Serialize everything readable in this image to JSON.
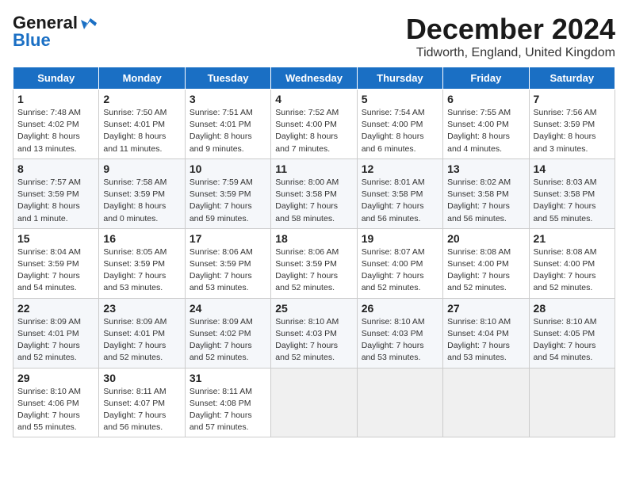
{
  "logo": {
    "line1": "General",
    "line2": "Blue"
  },
  "title": "December 2024",
  "subtitle": "Tidworth, England, United Kingdom",
  "days_of_week": [
    "Sunday",
    "Monday",
    "Tuesday",
    "Wednesday",
    "Thursday",
    "Friday",
    "Saturday"
  ],
  "weeks": [
    [
      {
        "day": 1,
        "sunrise": "7:48 AM",
        "sunset": "4:02 PM",
        "daylight": "8 hours and 13 minutes."
      },
      {
        "day": 2,
        "sunrise": "7:50 AM",
        "sunset": "4:01 PM",
        "daylight": "8 hours and 11 minutes."
      },
      {
        "day": 3,
        "sunrise": "7:51 AM",
        "sunset": "4:01 PM",
        "daylight": "8 hours and 9 minutes."
      },
      {
        "day": 4,
        "sunrise": "7:52 AM",
        "sunset": "4:00 PM",
        "daylight": "8 hours and 7 minutes."
      },
      {
        "day": 5,
        "sunrise": "7:54 AM",
        "sunset": "4:00 PM",
        "daylight": "8 hours and 6 minutes."
      },
      {
        "day": 6,
        "sunrise": "7:55 AM",
        "sunset": "4:00 PM",
        "daylight": "8 hours and 4 minutes."
      },
      {
        "day": 7,
        "sunrise": "7:56 AM",
        "sunset": "3:59 PM",
        "daylight": "8 hours and 3 minutes."
      }
    ],
    [
      {
        "day": 8,
        "sunrise": "7:57 AM",
        "sunset": "3:59 PM",
        "daylight": "8 hours and 1 minute."
      },
      {
        "day": 9,
        "sunrise": "7:58 AM",
        "sunset": "3:59 PM",
        "daylight": "8 hours and 0 minutes."
      },
      {
        "day": 10,
        "sunrise": "7:59 AM",
        "sunset": "3:59 PM",
        "daylight": "7 hours and 59 minutes."
      },
      {
        "day": 11,
        "sunrise": "8:00 AM",
        "sunset": "3:58 PM",
        "daylight": "7 hours and 58 minutes."
      },
      {
        "day": 12,
        "sunrise": "8:01 AM",
        "sunset": "3:58 PM",
        "daylight": "7 hours and 56 minutes."
      },
      {
        "day": 13,
        "sunrise": "8:02 AM",
        "sunset": "3:58 PM",
        "daylight": "7 hours and 56 minutes."
      },
      {
        "day": 14,
        "sunrise": "8:03 AM",
        "sunset": "3:58 PM",
        "daylight": "7 hours and 55 minutes."
      }
    ],
    [
      {
        "day": 15,
        "sunrise": "8:04 AM",
        "sunset": "3:59 PM",
        "daylight": "7 hours and 54 minutes."
      },
      {
        "day": 16,
        "sunrise": "8:05 AM",
        "sunset": "3:59 PM",
        "daylight": "7 hours and 53 minutes."
      },
      {
        "day": 17,
        "sunrise": "8:06 AM",
        "sunset": "3:59 PM",
        "daylight": "7 hours and 53 minutes."
      },
      {
        "day": 18,
        "sunrise": "8:06 AM",
        "sunset": "3:59 PM",
        "daylight": "7 hours and 52 minutes."
      },
      {
        "day": 19,
        "sunrise": "8:07 AM",
        "sunset": "4:00 PM",
        "daylight": "7 hours and 52 minutes."
      },
      {
        "day": 20,
        "sunrise": "8:08 AM",
        "sunset": "4:00 PM",
        "daylight": "7 hours and 52 minutes."
      },
      {
        "day": 21,
        "sunrise": "8:08 AM",
        "sunset": "4:00 PM",
        "daylight": "7 hours and 52 minutes."
      }
    ],
    [
      {
        "day": 22,
        "sunrise": "8:09 AM",
        "sunset": "4:01 PM",
        "daylight": "7 hours and 52 minutes."
      },
      {
        "day": 23,
        "sunrise": "8:09 AM",
        "sunset": "4:01 PM",
        "daylight": "7 hours and 52 minutes."
      },
      {
        "day": 24,
        "sunrise": "8:09 AM",
        "sunset": "4:02 PM",
        "daylight": "7 hours and 52 minutes."
      },
      {
        "day": 25,
        "sunrise": "8:10 AM",
        "sunset": "4:03 PM",
        "daylight": "7 hours and 52 minutes."
      },
      {
        "day": 26,
        "sunrise": "8:10 AM",
        "sunset": "4:03 PM",
        "daylight": "7 hours and 53 minutes."
      },
      {
        "day": 27,
        "sunrise": "8:10 AM",
        "sunset": "4:04 PM",
        "daylight": "7 hours and 53 minutes."
      },
      {
        "day": 28,
        "sunrise": "8:10 AM",
        "sunset": "4:05 PM",
        "daylight": "7 hours and 54 minutes."
      }
    ],
    [
      {
        "day": 29,
        "sunrise": "8:10 AM",
        "sunset": "4:06 PM",
        "daylight": "7 hours and 55 minutes."
      },
      {
        "day": 30,
        "sunrise": "8:11 AM",
        "sunset": "4:07 PM",
        "daylight": "7 hours and 56 minutes."
      },
      {
        "day": 31,
        "sunrise": "8:11 AM",
        "sunset": "4:08 PM",
        "daylight": "7 hours and 57 minutes."
      },
      null,
      null,
      null,
      null
    ]
  ]
}
